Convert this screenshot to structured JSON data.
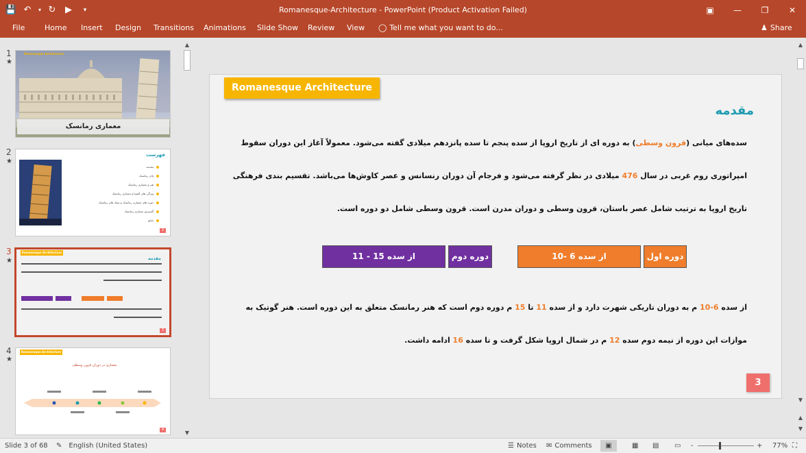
{
  "app": {
    "title": "Romanesque-Architecture - PowerPoint (Product Activation Failed)",
    "qat_icons": [
      "save-icon",
      "undo-icon",
      "redo-icon",
      "start-from-beginning-icon",
      "customize-icon"
    ],
    "window_buttons": [
      "ribbon-display-icon",
      "minimize-icon",
      "restore-icon",
      "close-icon"
    ]
  },
  "ribbon": {
    "tabs": [
      "File",
      "Home",
      "Insert",
      "Design",
      "Transitions",
      "Animations",
      "Slide Show",
      "Review",
      "View"
    ],
    "tell_me": "Tell me what you want to do...",
    "share": "Share"
  },
  "thumbnails": [
    {
      "num": "1",
      "star": "★",
      "caption": "معماری رمانسک",
      "badge": "Romanesque Architecture"
    },
    {
      "num": "2",
      "star": "★",
      "title": "فهرست",
      "items": [
        "مقدمه",
        "پلان رمانسک",
        "هنر و معماری رمانسک",
        "ویژگی های کلیسا و معماری رمانسک",
        "حوزه های معماری رمانسک و سبک های رمانسک",
        "گسترش معماری رمانسک",
        "منابع"
      ],
      "page": "2"
    },
    {
      "num": "3",
      "star": "★",
      "badge": "Romanesque Architecture",
      "heading": "مقدمه",
      "page": "3"
    },
    {
      "num": "4",
      "star": "★",
      "badge": "Romanesque Architecture",
      "title": "معماری در دوران قرون وسطی",
      "page": "4"
    }
  ],
  "slide": {
    "badge": "Romanesque Architecture",
    "heading": "مقدمه",
    "para1": {
      "a": "سده‌های میانی (",
      "h1": "قرون وسطی",
      "b": ") به دوره ای از تاریخ اروپا از سده پنجم تا سده پانزدهم میلادی گفته می‌شود. معمولاً آغاز این دوران سقوط امپراتوری روم غربی در سال ",
      "h2": "476",
      "c": " میلادی در نظر گرفته می‌شود و فرجام آن دوران رنسانس و عصر کاوش‌ها می‌باشد. تقسیم بندی فرهنگی تاریخ اروپا به ترتیب شامل عصر باستان، قرون وسطی و دوران مدرن است.  قرون وسطی شامل دو دوره است."
    },
    "boxes": {
      "first_label": "دوره اول",
      "first_range": "از سده 6 -10",
      "second_label": "دوره دوم",
      "second_range": "از سده 15 - 11"
    },
    "para2": {
      "a": "از سده ",
      "h1": "6-10",
      "b": " م به دوران تاریکی شهرت دارد و از سده ",
      "h2": "11",
      "c": " تا ",
      "h3": "15",
      "d": " م دوره دوم است که هنر رمانسک متعلق به این دوره است. هنر گوتیک به موازات این دوره از نیمه دوم سده ",
      "h4": "12",
      "e": " م در شمال اروپا شکل گرفت و تا سده ",
      "h5": "16",
      "f": " ادامه داشت."
    },
    "page_number": "3"
  },
  "statusbar": {
    "slide_info": "Slide 3 of 68",
    "language": "English (United States)",
    "notes": "Notes",
    "comments": "Comments",
    "zoom": "77%",
    "minus": "-",
    "plus": "+"
  },
  "colors": {
    "accent": "#b7472a",
    "badge": "#f7b500",
    "orange": "#ef7d2b",
    "purple": "#7030a0",
    "teal": "#1d9bb1"
  }
}
